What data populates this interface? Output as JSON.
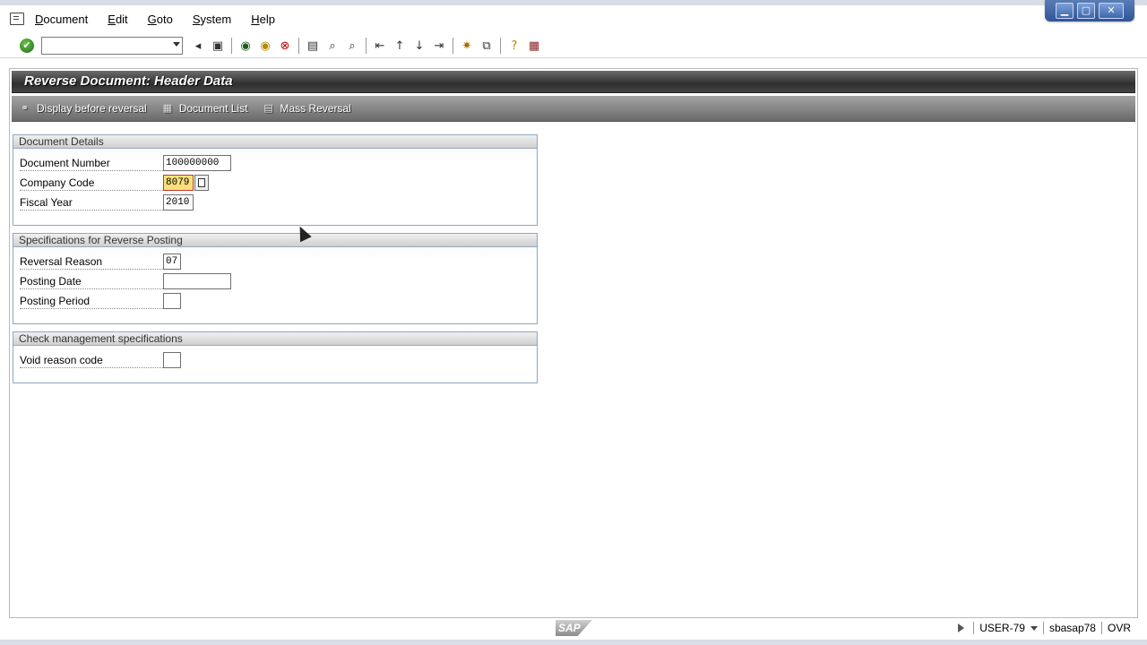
{
  "menubar": {
    "items": [
      "Document",
      "Edit",
      "Goto",
      "System",
      "Help"
    ]
  },
  "window_controls": {
    "minimize": "▁",
    "maximize": "▢",
    "close": "✕"
  },
  "toolbar": {
    "command_field": "",
    "icons": [
      "enter-icon",
      "back-icon",
      "save-icon",
      "back-arrow-icon",
      "exit-icon",
      "cancel-icon",
      "print-icon",
      "find-icon",
      "find-next-icon",
      "first-page-icon",
      "prev-page-icon",
      "next-page-icon",
      "last-page-icon",
      "create-session-icon",
      "shortcut-icon",
      "help-icon",
      "layout-icon"
    ]
  },
  "title": "Reverse Document: Header Data",
  "app_toolbar": {
    "display_before_reversal": "Display before reversal",
    "document_list": "Document List",
    "mass_reversal": "Mass Reversal"
  },
  "groups": {
    "document_details": {
      "title": "Document Details",
      "document_number_label": "Document Number",
      "document_number_value": "100000000",
      "company_code_label": "Company Code",
      "company_code_value": "8079",
      "fiscal_year_label": "Fiscal Year",
      "fiscal_year_value": "2010"
    },
    "reverse_posting": {
      "title": "Specifications for Reverse Posting",
      "reversal_reason_label": "Reversal Reason",
      "reversal_reason_value": "07",
      "posting_date_label": "Posting Date",
      "posting_date_value": "",
      "posting_period_label": "Posting Period",
      "posting_period_value": ""
    },
    "check_management": {
      "title": "Check management specifications",
      "void_reason_label": "Void reason code",
      "void_reason_value": ""
    }
  },
  "statusbar": {
    "logo": "SAP",
    "user": "USER-79",
    "server": "sbasap78",
    "mode": "OVR"
  }
}
